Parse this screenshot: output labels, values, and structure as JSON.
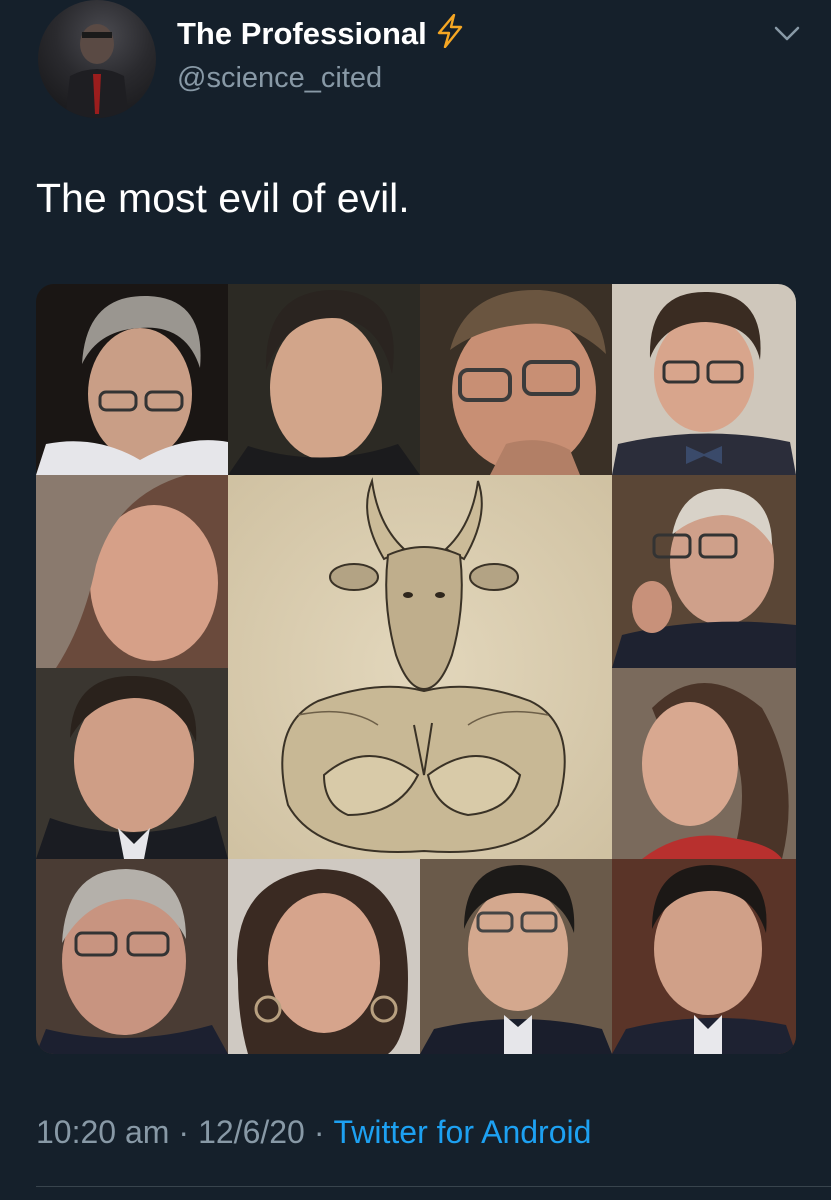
{
  "tweet": {
    "author": {
      "display_name": "The Professional",
      "verified_icon": "lightning-bolt-icon",
      "handle": "@science_cited"
    },
    "text": "The most evil of evil.",
    "media": {
      "type": "photo-collage",
      "tiles": [
        {
          "name": "portrait-gray-hair-glasses-man"
        },
        {
          "name": "portrait-slicked-hair-man"
        },
        {
          "name": "portrait-glasses-man-hand-on-chin"
        },
        {
          "name": "portrait-glasses-bowtie-man"
        },
        {
          "name": "portrait-short-hair-woman"
        },
        {
          "name": "engraving-bull-headed-idol"
        },
        {
          "name": "portrait-elderly-glasses-man"
        },
        {
          "name": "portrait-dark-hair-man"
        },
        {
          "name": "portrait-curly-hair-woman"
        },
        {
          "name": "portrait-gray-hair-glasses-man-2"
        },
        {
          "name": "portrait-woman-earrings"
        },
        {
          "name": "portrait-glasses-man-suit"
        },
        {
          "name": "portrait-dark-hair-man-suit"
        }
      ]
    },
    "time": "10:20 am",
    "date": "12/6/20",
    "separator": "·",
    "source": "Twitter for Android"
  },
  "colors": {
    "background": "#15202b",
    "secondary_text": "#8899a6",
    "link": "#1da1f2",
    "bolt": "#f5a623"
  }
}
